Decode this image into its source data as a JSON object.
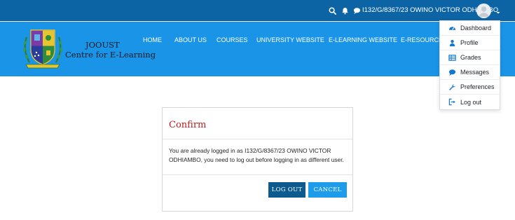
{
  "topbar": {
    "user_name": "I132/G/8367/23 OWINO VICTOR ODHIAMBO"
  },
  "brand": {
    "line1": "JOOUST",
    "line2": "Centre for E-Learning",
    "logo_ribbon": "WISDOM, INTEGRITY, PROGRESS"
  },
  "nav": {
    "home": "HOME",
    "about": "ABOUT US",
    "courses": "COURSES",
    "university": "UNIVERSITY WEBSITE",
    "elearning": "E-LEARNING WEBSITE",
    "resources": "E-RESOURCES"
  },
  "user_menu": {
    "items": [
      {
        "label": "Dashboard",
        "icon": "dashboard-icon"
      },
      {
        "label": "Profile",
        "icon": "user-icon"
      },
      {
        "label": "Grades",
        "icon": "table-icon"
      },
      {
        "label": "Messages",
        "icon": "chat-icon"
      },
      {
        "label": "Preferences",
        "icon": "wrench-icon"
      },
      {
        "label": "Log out",
        "icon": "sign-out-icon"
      }
    ]
  },
  "dialog": {
    "title": "Confirm",
    "message": "You are already logged in as I132/G/8367/23 OWINO VICTOR ODHIAMBO, you need to log out before logging in as different user.",
    "logout_label": "LOG OUT",
    "cancel_label": "CANCEL"
  },
  "colors": {
    "topbar": "#0d64a4",
    "banner": "#1a94e6",
    "title_red": "#b51d1d",
    "logout_button": "#0d5a8e",
    "cancel_button": "#1c9cea"
  }
}
